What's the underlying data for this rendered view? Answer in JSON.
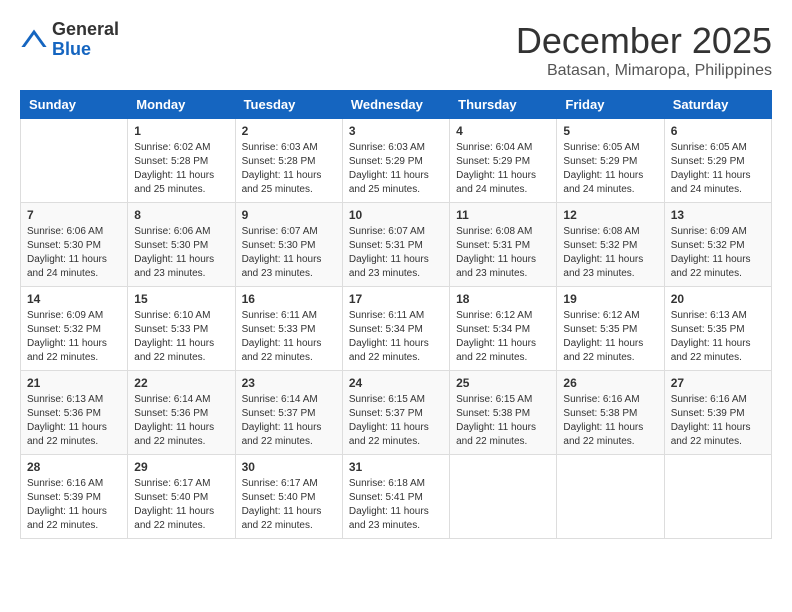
{
  "header": {
    "logo_line1": "General",
    "logo_line2": "Blue",
    "month_title": "December 2025",
    "subtitle": "Batasan, Mimaropa, Philippines"
  },
  "calendar": {
    "days_of_week": [
      "Sunday",
      "Monday",
      "Tuesday",
      "Wednesday",
      "Thursday",
      "Friday",
      "Saturday"
    ],
    "weeks": [
      [
        {
          "day": "",
          "info": ""
        },
        {
          "day": "1",
          "info": "Sunrise: 6:02 AM\nSunset: 5:28 PM\nDaylight: 11 hours\nand 25 minutes."
        },
        {
          "day": "2",
          "info": "Sunrise: 6:03 AM\nSunset: 5:28 PM\nDaylight: 11 hours\nand 25 minutes."
        },
        {
          "day": "3",
          "info": "Sunrise: 6:03 AM\nSunset: 5:29 PM\nDaylight: 11 hours\nand 25 minutes."
        },
        {
          "day": "4",
          "info": "Sunrise: 6:04 AM\nSunset: 5:29 PM\nDaylight: 11 hours\nand 24 minutes."
        },
        {
          "day": "5",
          "info": "Sunrise: 6:05 AM\nSunset: 5:29 PM\nDaylight: 11 hours\nand 24 minutes."
        },
        {
          "day": "6",
          "info": "Sunrise: 6:05 AM\nSunset: 5:29 PM\nDaylight: 11 hours\nand 24 minutes."
        }
      ],
      [
        {
          "day": "7",
          "info": "Sunrise: 6:06 AM\nSunset: 5:30 PM\nDaylight: 11 hours\nand 24 minutes."
        },
        {
          "day": "8",
          "info": "Sunrise: 6:06 AM\nSunset: 5:30 PM\nDaylight: 11 hours\nand 23 minutes."
        },
        {
          "day": "9",
          "info": "Sunrise: 6:07 AM\nSunset: 5:30 PM\nDaylight: 11 hours\nand 23 minutes."
        },
        {
          "day": "10",
          "info": "Sunrise: 6:07 AM\nSunset: 5:31 PM\nDaylight: 11 hours\nand 23 minutes."
        },
        {
          "day": "11",
          "info": "Sunrise: 6:08 AM\nSunset: 5:31 PM\nDaylight: 11 hours\nand 23 minutes."
        },
        {
          "day": "12",
          "info": "Sunrise: 6:08 AM\nSunset: 5:32 PM\nDaylight: 11 hours\nand 23 minutes."
        },
        {
          "day": "13",
          "info": "Sunrise: 6:09 AM\nSunset: 5:32 PM\nDaylight: 11 hours\nand 22 minutes."
        }
      ],
      [
        {
          "day": "14",
          "info": "Sunrise: 6:09 AM\nSunset: 5:32 PM\nDaylight: 11 hours\nand 22 minutes."
        },
        {
          "day": "15",
          "info": "Sunrise: 6:10 AM\nSunset: 5:33 PM\nDaylight: 11 hours\nand 22 minutes."
        },
        {
          "day": "16",
          "info": "Sunrise: 6:11 AM\nSunset: 5:33 PM\nDaylight: 11 hours\nand 22 minutes."
        },
        {
          "day": "17",
          "info": "Sunrise: 6:11 AM\nSunset: 5:34 PM\nDaylight: 11 hours\nand 22 minutes."
        },
        {
          "day": "18",
          "info": "Sunrise: 6:12 AM\nSunset: 5:34 PM\nDaylight: 11 hours\nand 22 minutes."
        },
        {
          "day": "19",
          "info": "Sunrise: 6:12 AM\nSunset: 5:35 PM\nDaylight: 11 hours\nand 22 minutes."
        },
        {
          "day": "20",
          "info": "Sunrise: 6:13 AM\nSunset: 5:35 PM\nDaylight: 11 hours\nand 22 minutes."
        }
      ],
      [
        {
          "day": "21",
          "info": "Sunrise: 6:13 AM\nSunset: 5:36 PM\nDaylight: 11 hours\nand 22 minutes."
        },
        {
          "day": "22",
          "info": "Sunrise: 6:14 AM\nSunset: 5:36 PM\nDaylight: 11 hours\nand 22 minutes."
        },
        {
          "day": "23",
          "info": "Sunrise: 6:14 AM\nSunset: 5:37 PM\nDaylight: 11 hours\nand 22 minutes."
        },
        {
          "day": "24",
          "info": "Sunrise: 6:15 AM\nSunset: 5:37 PM\nDaylight: 11 hours\nand 22 minutes."
        },
        {
          "day": "25",
          "info": "Sunrise: 6:15 AM\nSunset: 5:38 PM\nDaylight: 11 hours\nand 22 minutes."
        },
        {
          "day": "26",
          "info": "Sunrise: 6:16 AM\nSunset: 5:38 PM\nDaylight: 11 hours\nand 22 minutes."
        },
        {
          "day": "27",
          "info": "Sunrise: 6:16 AM\nSunset: 5:39 PM\nDaylight: 11 hours\nand 22 minutes."
        }
      ],
      [
        {
          "day": "28",
          "info": "Sunrise: 6:16 AM\nSunset: 5:39 PM\nDaylight: 11 hours\nand 22 minutes."
        },
        {
          "day": "29",
          "info": "Sunrise: 6:17 AM\nSunset: 5:40 PM\nDaylight: 11 hours\nand 22 minutes."
        },
        {
          "day": "30",
          "info": "Sunrise: 6:17 AM\nSunset: 5:40 PM\nDaylight: 11 hours\nand 22 minutes."
        },
        {
          "day": "31",
          "info": "Sunrise: 6:18 AM\nSunset: 5:41 PM\nDaylight: 11 hours\nand 23 minutes."
        },
        {
          "day": "",
          "info": ""
        },
        {
          "day": "",
          "info": ""
        },
        {
          "day": "",
          "info": ""
        }
      ]
    ]
  }
}
